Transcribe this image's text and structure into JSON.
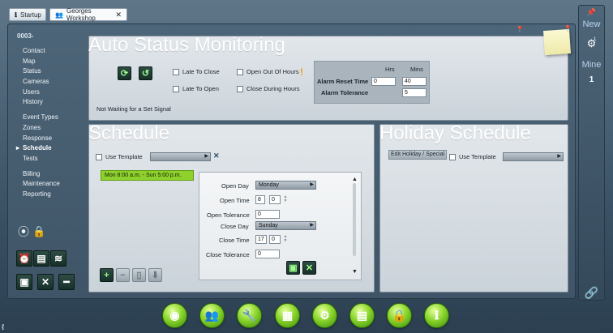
{
  "tabs": [
    {
      "label": "Startup"
    },
    {
      "label": "Georges Workshop"
    }
  ],
  "nav": {
    "account": "0003-",
    "items": [
      "Contact",
      "Map",
      "Status",
      "Cameras",
      "Users",
      "History"
    ],
    "items2": [
      "Event Types",
      "Zones",
      "Response",
      "Schedule",
      "Tests"
    ],
    "items3": [
      "Billing",
      "Maintenance",
      "Reporting"
    ],
    "selected": "Schedule"
  },
  "auto_status": {
    "title": "Auto Status Monitoring",
    "late_to_close": "Late To Close",
    "late_to_open": "Late To Open",
    "open_out_of_hours": "Open Out Of Hours",
    "close_during_hours": "Close During Hours",
    "status_text": "Not Waiting for a Set Signal",
    "hrs_header": "Hrs",
    "mins_header": "Mins",
    "alarm_reset_time_label": "Alarm Reset Time",
    "alarm_reset_hrs": "0",
    "alarm_reset_mins": "40",
    "alarm_tolerance_label": "Alarm Tolerance",
    "alarm_tolerance_mins": "5"
  },
  "schedule": {
    "title": "Schedule",
    "use_template": "Use Template",
    "entry": "Mon 8:00 a.m. - Sun 5:00 p.m.",
    "open_day_label": "Open Day",
    "open_day_value": "Monday",
    "open_time_label": "Open Time",
    "open_time_hour": "8",
    "open_time_min": "0",
    "open_tolerance_label": "Open Tolerance",
    "open_tolerance_value": "0",
    "close_day_label": "Close Day",
    "close_day_value": "Sunday",
    "close_time_label": "Close Time",
    "close_time_hour": "17",
    "close_time_min": "0",
    "close_tolerance_label": "Close Tolerance",
    "close_tolerance_value": "0"
  },
  "holiday": {
    "title": "Holiday Schedule",
    "edit_button": "Edit Holiday / Special",
    "use_template": "Use Template"
  },
  "right_strip": {
    "new_label": "New",
    "mine_label": "Mine",
    "count": "1",
    "badge": "1"
  },
  "colors": {
    "accent_green": "#8ad52b",
    "schedule_entry_bg": "#8fd12c",
    "card_bg": "#d6dde2",
    "warning": "#f39c12"
  }
}
